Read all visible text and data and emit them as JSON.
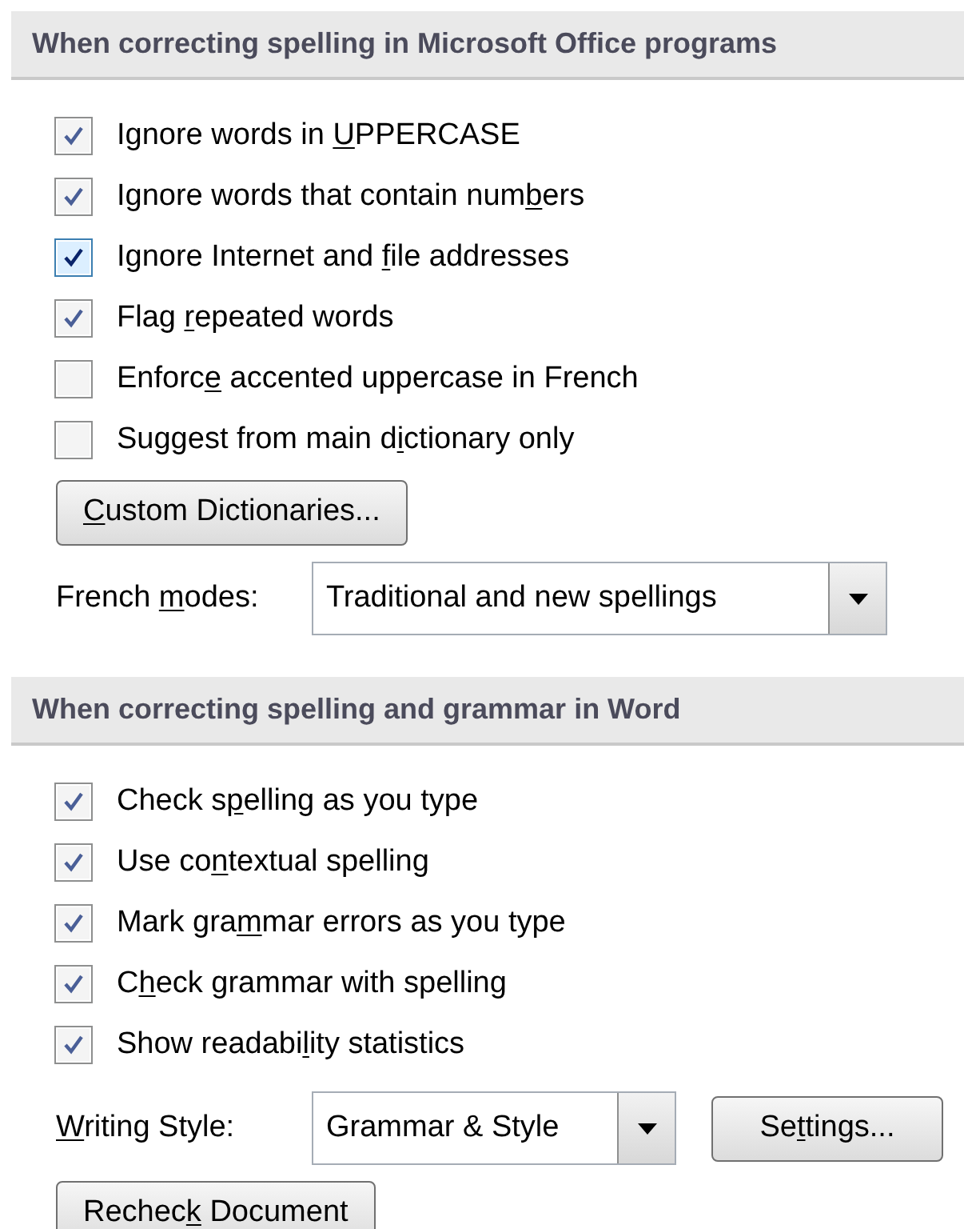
{
  "sections": [
    {
      "title": "When correcting spelling in Microsoft Office programs",
      "options": [
        {
          "label": {
            "before": "Ignore words in ",
            "key": "U",
            "after": "PPERCASE"
          },
          "checked": true,
          "hovered": false
        },
        {
          "label": {
            "before": "Ignore words that contain num",
            "key": "b",
            "after": "ers"
          },
          "checked": true,
          "hovered": false
        },
        {
          "label": {
            "before": "Ignore Internet and ",
            "key": "f",
            "after": "ile addresses"
          },
          "checked": true,
          "hovered": true
        },
        {
          "label": {
            "before": "Flag ",
            "key": "r",
            "after": "epeated words"
          },
          "checked": true,
          "hovered": false
        },
        {
          "label": {
            "before": "Enforc",
            "key": "e",
            "after": " accented uppercase in French"
          },
          "checked": false,
          "hovered": false
        },
        {
          "label": {
            "before": "Suggest from main d",
            "key": "i",
            "after": "ctionary only"
          },
          "checked": false,
          "hovered": false
        }
      ],
      "controls": [
        {
          "kind": "button",
          "label": {
            "key": "C",
            "after": "ustom Dictionaries..."
          }
        },
        {
          "kind": "dropdown",
          "label": {
            "before": "French ",
            "key": "m",
            "after": "odes:"
          },
          "value": "Traditional and new spellings"
        }
      ]
    },
    {
      "title": "When correcting spelling and grammar in Word",
      "options": [
        {
          "label": {
            "before": "Check s",
            "key": "p",
            "after": "elling as you type"
          },
          "checked": true,
          "hovered": false
        },
        {
          "label": {
            "before": "Use co",
            "key": "n",
            "after": "textual spelling"
          },
          "checked": true,
          "hovered": false
        },
        {
          "label": {
            "before": "Mark gra",
            "key": "m",
            "after": "mar errors as you type"
          },
          "checked": true,
          "hovered": false
        },
        {
          "label": {
            "before": "C",
            "key": "h",
            "after": "eck grammar with spelling"
          },
          "checked": true,
          "hovered": false
        },
        {
          "label": {
            "before": "Show readabi",
            "key": "l",
            "after": "ity statistics"
          },
          "checked": true,
          "hovered": false
        }
      ],
      "controls": [
        {
          "kind": "dropdown",
          "label": {
            "key": "W",
            "after": "riting Style:"
          },
          "value": "Grammar & Style",
          "button": {
            "before": "Se",
            "key": "t",
            "after": "tings..."
          }
        },
        {
          "kind": "button",
          "label": {
            "before": "Rechec",
            "key": "k",
            "after": " Document"
          }
        }
      ]
    }
  ]
}
